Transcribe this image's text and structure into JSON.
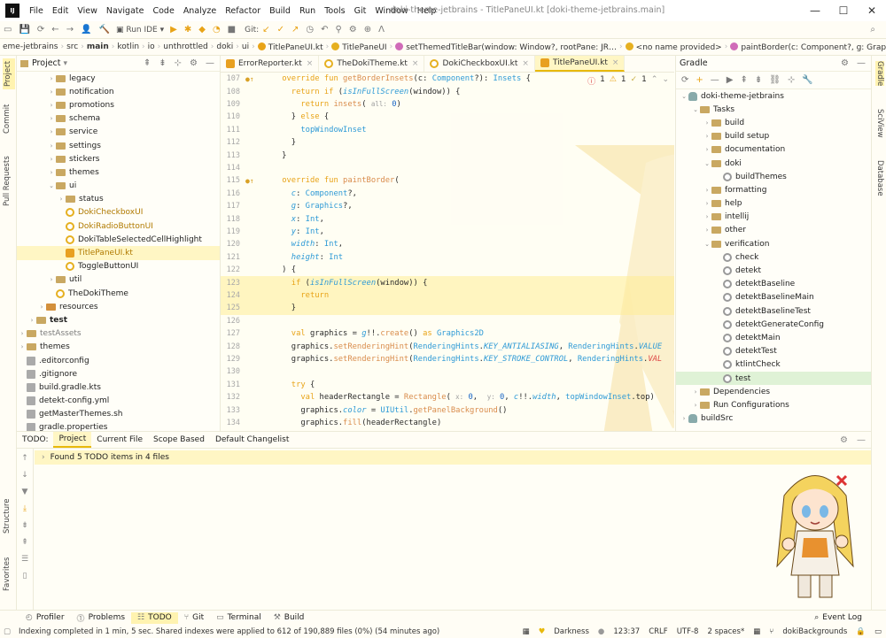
{
  "titlebar": {
    "app_icon": "IJ",
    "menu": [
      "File",
      "Edit",
      "View",
      "Navigate",
      "Code",
      "Analyze",
      "Refactor",
      "Build",
      "Run",
      "Tools",
      "Git",
      "Window",
      "Help"
    ],
    "window_title": "doki-theme-jetbrains - TitlePaneUI.kt [doki-theme-jetbrains.main]",
    "minimize": "—",
    "maximize": "☐",
    "close": "✕"
  },
  "toolbar": {
    "run_config": "Run IDE",
    "git_label": "Git:"
  },
  "breadcrumb": {
    "items": [
      "eme-jetbrains",
      "src",
      "main",
      "kotlin",
      "io",
      "unthrottled",
      "doki",
      "ui",
      "TitlePaneUI.kt",
      "TitlePaneUI",
      "setThemedTitleBar(window: Window?, rootPane: JR…",
      "<no name provided>",
      "paintBorder(c: Component?, g: Graphics?, x: Int…"
    ]
  },
  "left_strip": {
    "tabs": [
      "Project",
      "Commit",
      "Pull Requests"
    ],
    "bottom_tabs": [
      "Structure",
      "Favorites"
    ]
  },
  "right_strip": {
    "tabs": [
      "Gradle",
      "SciView",
      "Database"
    ]
  },
  "project_panel": {
    "title": "Project",
    "tree": [
      {
        "label": "legacy",
        "indent": 4,
        "type": "folder",
        "arrow": "›"
      },
      {
        "label": "notification",
        "indent": 4,
        "type": "folder",
        "arrow": "›"
      },
      {
        "label": "promotions",
        "indent": 4,
        "type": "folder",
        "arrow": "›"
      },
      {
        "label": "schema",
        "indent": 4,
        "type": "folder",
        "arrow": "›"
      },
      {
        "label": "service",
        "indent": 4,
        "type": "folder",
        "arrow": "›"
      },
      {
        "label": "settings",
        "indent": 4,
        "type": "folder",
        "arrow": "›"
      },
      {
        "label": "stickers",
        "indent": 4,
        "type": "folder",
        "arrow": "›"
      },
      {
        "label": "themes",
        "indent": 4,
        "type": "folder",
        "arrow": "›"
      },
      {
        "label": "ui",
        "indent": 4,
        "type": "folder",
        "arrow": "⌄"
      },
      {
        "label": "status",
        "indent": 5,
        "type": "folder",
        "arrow": "›"
      },
      {
        "label": "DokiCheckboxUI",
        "indent": 5,
        "type": "class",
        "arrow": "",
        "mod": true
      },
      {
        "label": "DokiRadioButtonUI",
        "indent": 5,
        "type": "class",
        "arrow": "",
        "mod": true
      },
      {
        "label": "DokiTableSelectedCellHighlight",
        "indent": 5,
        "type": "class",
        "arrow": ""
      },
      {
        "label": "TitlePaneUI.kt",
        "indent": 5,
        "type": "kotlin",
        "arrow": "",
        "mod": true,
        "selected": true
      },
      {
        "label": "ToggleButtonUI",
        "indent": 5,
        "type": "class",
        "arrow": ""
      },
      {
        "label": "util",
        "indent": 4,
        "type": "folder",
        "arrow": "›"
      },
      {
        "label": "TheDokiTheme",
        "indent": 4,
        "type": "class",
        "arrow": ""
      },
      {
        "label": "resources",
        "indent": 3,
        "type": "folder-res",
        "arrow": "›"
      },
      {
        "label": "test",
        "indent": 2,
        "type": "folder",
        "arrow": "›",
        "bold": true
      },
      {
        "label": "testAssets",
        "indent": 1,
        "type": "folder",
        "arrow": "›",
        "muted": true
      },
      {
        "label": "themes",
        "indent": 1,
        "type": "folder",
        "arrow": "›"
      },
      {
        "label": ".editorconfig",
        "indent": 1,
        "type": "file",
        "arrow": ""
      },
      {
        "label": ".gitignore",
        "indent": 1,
        "type": "file",
        "arrow": ""
      },
      {
        "label": "build.gradle.kts",
        "indent": 1,
        "type": "file",
        "arrow": ""
      },
      {
        "label": "detekt-config.yml",
        "indent": 1,
        "type": "file",
        "arrow": ""
      },
      {
        "label": "getMasterThemes.sh",
        "indent": 1,
        "type": "file",
        "arrow": ""
      },
      {
        "label": "gradle.properties",
        "indent": 1,
        "type": "file",
        "arrow": ""
      }
    ]
  },
  "editor_tabs": [
    {
      "label": "ErrorReporter.kt",
      "selected": false
    },
    {
      "label": "TheDokiTheme.kt",
      "selected": false
    },
    {
      "label": "DokiCheckboxUI.kt",
      "selected": false
    },
    {
      "label": "TitlePaneUI.kt",
      "selected": true
    }
  ],
  "editor": {
    "inspections": {
      "errors": "1",
      "warnings": "1",
      "weak": "1"
    },
    "lines": [
      {
        "n": "107",
        "mark": "●↑",
        "html": "    <span class='kw'>override fun</span> <span class='fn'>getBorderInsets</span>(c: <span class='ty'>Component</span>?): <span class='ty'>Insets</span> {"
      },
      {
        "n": "108",
        "mark": "",
        "html": "      <span class='kw'>return if</span> (<span class='it'>isInFullScreen</span>(window)) {"
      },
      {
        "n": "109",
        "mark": "",
        "html": "        <span class='kw'>return</span> <span class='fn'>insets</span>( <span class='pm'>all:</span> <span class='nm'>0</span>)"
      },
      {
        "n": "110",
        "mark": "",
        "html": "      } <span class='kw'>else</span> {"
      },
      {
        "n": "111",
        "mark": "",
        "html": "        <span class='ty'>topWindowInset</span>"
      },
      {
        "n": "112",
        "mark": "",
        "html": "      }"
      },
      {
        "n": "113",
        "mark": "",
        "html": "    }"
      },
      {
        "n": "114",
        "mark": "",
        "html": ""
      },
      {
        "n": "115",
        "mark": "●↑",
        "html": "    <span class='kw'>override fun</span> <span class='fn'>paintBorder</span>("
      },
      {
        "n": "116",
        "mark": "",
        "html": "      <span class='it'>c</span>: <span class='ty'>Component</span>?,"
      },
      {
        "n": "117",
        "mark": "",
        "html": "      <span class='it'>g</span>: <span class='ty'>Graphics</span>?,"
      },
      {
        "n": "118",
        "mark": "",
        "html": "      <span class='it'>x</span>: <span class='ty'>Int</span>,"
      },
      {
        "n": "119",
        "mark": "",
        "html": "      <span class='it'>y</span>: <span class='ty'>Int</span>,"
      },
      {
        "n": "120",
        "mark": "",
        "html": "      <span class='it'>width</span>: <span class='ty'>Int</span>,"
      },
      {
        "n": "121",
        "mark": "",
        "html": "      <span class='it'>height</span>: <span class='ty'>Int</span>"
      },
      {
        "n": "122",
        "mark": "",
        "html": "    ) {"
      },
      {
        "n": "123",
        "mark": "",
        "html": "      <span class='kw'>if</span> (<span class='it'>isInFullScreen</span>(window)) {",
        "hl": true
      },
      {
        "n": "124",
        "mark": "",
        "html": "        <span class='kw'>return</span>",
        "hl": true
      },
      {
        "n": "125",
        "mark": "",
        "html": "      }",
        "hl": true
      },
      {
        "n": "126",
        "mark": "",
        "html": ""
      },
      {
        "n": "127",
        "mark": "",
        "html": "      <span class='kw'>val</span> graphics = <span class='it'>g</span>!!.<span class='fn'>create</span>() <span class='kw'>as</span> <span class='ty'>Graphics2D</span>"
      },
      {
        "n": "128",
        "mark": "",
        "html": "      graphics.<span class='fn'>setRenderingHint</span>(<span class='ty'>RenderingHints</span>.<span class='it'>KEY_ANTIALIASING</span>, <span class='ty'>RenderingHints</span>.<span class='it'>VALUE</span>"
      },
      {
        "n": "129",
        "mark": "",
        "html": "      graphics.<span class='fn'>setRenderingHint</span>(<span class='ty'>RenderingHints</span>.<span class='it'>KEY_STROKE_CONTROL</span>, <span class='ty'>RenderingHints</span>.<span class='it' style='color:#d44'>VAL</span>"
      },
      {
        "n": "130",
        "mark": "",
        "html": ""
      },
      {
        "n": "131",
        "mark": "",
        "html": "      <span class='kw'>try</span> {"
      },
      {
        "n": "132",
        "mark": "",
        "html": "        <span class='kw'>val</span> headerRectangle = <span class='fn'>Rectangle</span>( <span class='pm'>x:</span> <span class='nm'>0</span>,  <span class='pm'>y:</span> <span class='nm'>0</span>, <span class='it'>c</span>!!.<span class='it'>width</span>, <span class='ty'>topWindowInset</span>.top)"
      },
      {
        "n": "133",
        "mark": "",
        "html": "        graphics.<span class='it'>color</span> = <span class='ty'>UIUtil</span>.<span class='fn'>getPanelBackground</span>()"
      },
      {
        "n": "134",
        "mark": "",
        "html": "        graphics.<span class='fn'>fill</span>(headerRectangle)"
      }
    ]
  },
  "gradle_panel": {
    "title": "Gradle",
    "tree": [
      {
        "label": "doki-theme-jetbrains",
        "indent": 0,
        "arrow": "⌄",
        "icon": "elephant"
      },
      {
        "label": "Tasks",
        "indent": 1,
        "arrow": "⌄",
        "icon": "folder"
      },
      {
        "label": "build",
        "indent": 2,
        "arrow": "›",
        "icon": "folder"
      },
      {
        "label": "build setup",
        "indent": 2,
        "arrow": "›",
        "icon": "folder"
      },
      {
        "label": "documentation",
        "indent": 2,
        "arrow": "›",
        "icon": "folder"
      },
      {
        "label": "doki",
        "indent": 2,
        "arrow": "⌄",
        "icon": "folder"
      },
      {
        "label": "buildThemes",
        "indent": 3,
        "arrow": "",
        "icon": "gear"
      },
      {
        "label": "formatting",
        "indent": 2,
        "arrow": "›",
        "icon": "folder"
      },
      {
        "label": "help",
        "indent": 2,
        "arrow": "›",
        "icon": "folder"
      },
      {
        "label": "intellij",
        "indent": 2,
        "arrow": "›",
        "icon": "folder"
      },
      {
        "label": "other",
        "indent": 2,
        "arrow": "›",
        "icon": "folder"
      },
      {
        "label": "verification",
        "indent": 2,
        "arrow": "⌄",
        "icon": "folder"
      },
      {
        "label": "check",
        "indent": 3,
        "arrow": "",
        "icon": "gear"
      },
      {
        "label": "detekt",
        "indent": 3,
        "arrow": "",
        "icon": "gear"
      },
      {
        "label": "detektBaseline",
        "indent": 3,
        "arrow": "",
        "icon": "gear"
      },
      {
        "label": "detektBaselineMain",
        "indent": 3,
        "arrow": "",
        "icon": "gear"
      },
      {
        "label": "detektBaselineTest",
        "indent": 3,
        "arrow": "",
        "icon": "gear"
      },
      {
        "label": "detektGenerateConfig",
        "indent": 3,
        "arrow": "",
        "icon": "gear"
      },
      {
        "label": "detektMain",
        "indent": 3,
        "arrow": "",
        "icon": "gear"
      },
      {
        "label": "detektTest",
        "indent": 3,
        "arrow": "",
        "icon": "gear"
      },
      {
        "label": "ktlintCheck",
        "indent": 3,
        "arrow": "",
        "icon": "gear"
      },
      {
        "label": "test",
        "indent": 3,
        "arrow": "",
        "icon": "gear",
        "selected": true
      },
      {
        "label": "Dependencies",
        "indent": 1,
        "arrow": "›",
        "icon": "folder"
      },
      {
        "label": "Run Configurations",
        "indent": 1,
        "arrow": "›",
        "icon": "folder"
      },
      {
        "label": "buildSrc",
        "indent": 0,
        "arrow": "›",
        "icon": "elephant"
      }
    ]
  },
  "todo": {
    "label": "TODO:",
    "tabs": [
      "Project",
      "Current File",
      "Scope Based",
      "Default Changelist"
    ],
    "result": "Found 5 TODO items in 4 files"
  },
  "bottom_tools": [
    "Profiler",
    "Problems",
    "TODO",
    "Git",
    "Terminal",
    "Build"
  ],
  "event_log": "Event Log",
  "status": {
    "message": "Indexing completed in 1 min, 5 sec. Shared indexes were applied to 612 of 190,889 files (0%) (54 minutes ago)",
    "theme": "Darkness",
    "position": "123:37",
    "line_sep": "CRLF",
    "encoding": "UTF-8",
    "indent": "2 spaces*",
    "branch": "dokiBackgrounds"
  },
  "colors": {
    "accent": "#e8b90c",
    "selection": "#fff6c4",
    "keyword": "#e8a317",
    "type": "#2e9ad6"
  }
}
